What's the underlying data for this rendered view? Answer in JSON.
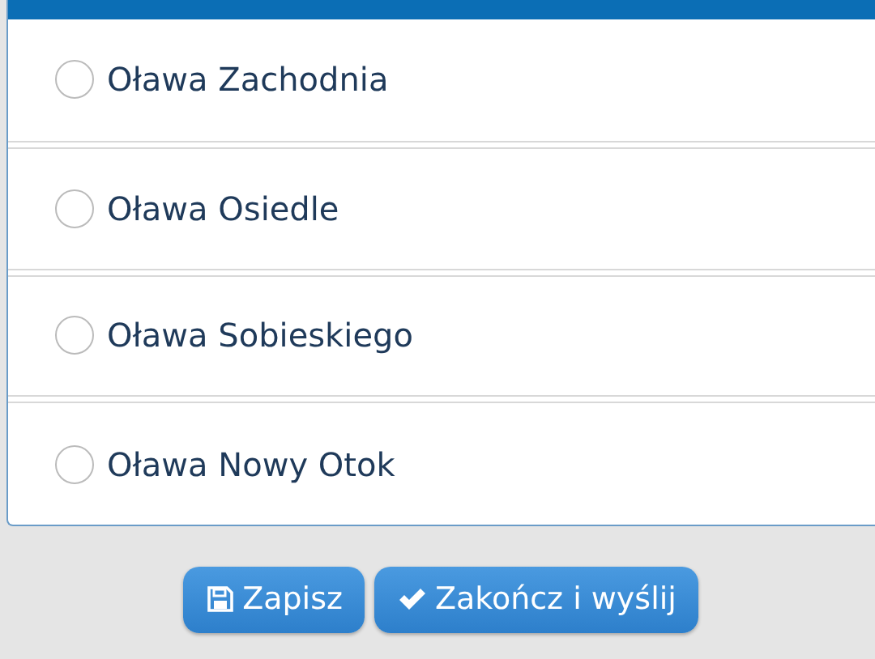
{
  "options": [
    {
      "label": "Oława Zachodnia",
      "selected": false
    },
    {
      "label": "Oława Osiedle",
      "selected": false
    },
    {
      "label": "Oława Sobieskiego",
      "selected": false
    },
    {
      "label": "Oława Nowy Otok",
      "selected": false
    }
  ],
  "buttons": [
    {
      "kind": "save",
      "label": "Zapisz"
    },
    {
      "kind": "finish",
      "label": "Zakończ i wyślij"
    }
  ]
}
